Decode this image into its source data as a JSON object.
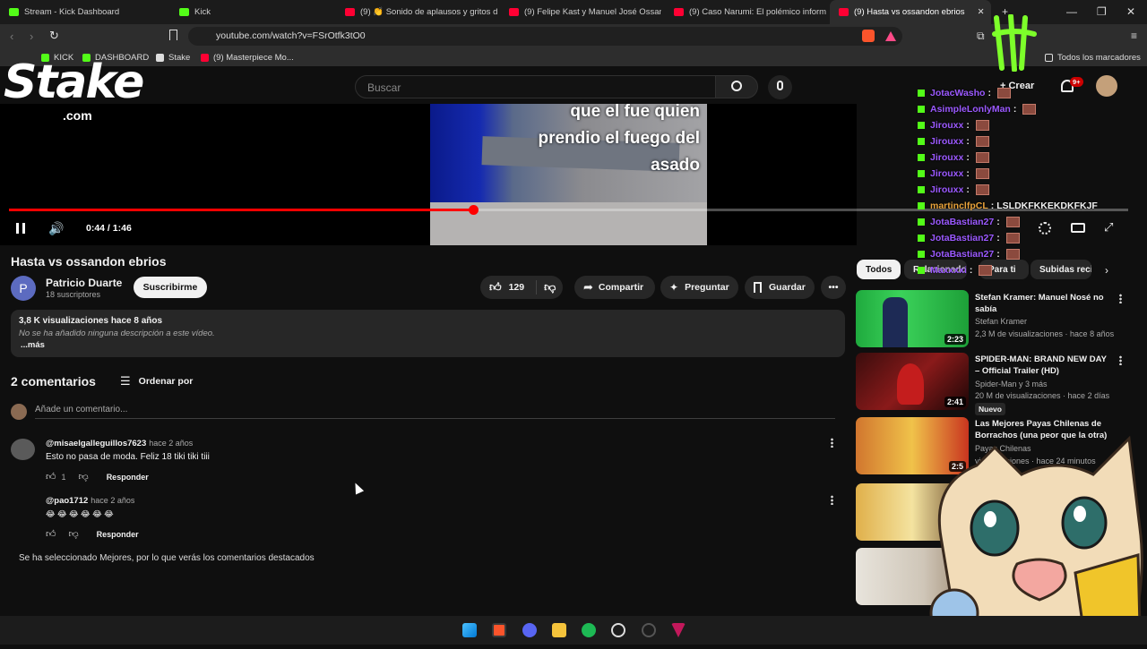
{
  "browser": {
    "tabs": [
      {
        "label": "Stream - Kick Dashboard",
        "favicon": "kick"
      },
      {
        "label": "Kick",
        "favicon": "kick"
      },
      {
        "label": "(9) 👏 Sonido de aplausos y gritos de",
        "favicon": "youtube"
      },
      {
        "label": "(9) Felipe Kast y Manuel José Ossand",
        "favicon": "youtube"
      },
      {
        "label": "(9) Caso Narumi: El polémico informe",
        "favicon": "youtube"
      },
      {
        "label": "(9) Hasta vs ossandon ebrios",
        "favicon": "youtube",
        "active": true
      }
    ],
    "url": "youtube.com/watch?v=FSrOtfk3tO0",
    "bookmarks": [
      {
        "label": "KICK",
        "icon": "kick"
      },
      {
        "label": "DASHBOARD",
        "icon": "kick"
      },
      {
        "label": "Stake",
        "icon": "stake"
      },
      {
        "label": "(9) Masterpiece Mo...",
        "icon": "youtube"
      }
    ],
    "all_bookmarks_label": "Todos los marcadores"
  },
  "youtube": {
    "search_placeholder": "Buscar",
    "create_label": "Crear",
    "notification_count": "9+",
    "player": {
      "caption_line1": "que el fue quien",
      "caption_line2": "prendio el fuego del",
      "caption_line3": "asado",
      "time": "0:44 / 1:46",
      "progress": 0.4151
    },
    "video": {
      "title": "Hasta vs ossandon ebrios",
      "channel": "Patricio Duarte",
      "channel_initial": "P",
      "subscribers": "18 suscriptores",
      "subscribe_label": "Suscribirme",
      "likes": "129",
      "share_label": "Compartir",
      "ask_label": "Preguntar",
      "save_label": "Guardar",
      "views_date": "3,8 K visualizaciones  hace 8 años",
      "description": "No se ha añadido ninguna descripción a este vídeo.",
      "more_label": "...más"
    },
    "comments": {
      "count_label": "2 comentarios",
      "sort_label": "Ordenar por",
      "add_placeholder": "Añade un comentario...",
      "items": [
        {
          "author": "@misaelgalleguillos7623",
          "time": "hace 2 años",
          "text": "Esto no pasa de moda. Feliz 18 tiki tiki tiii",
          "likes": "1",
          "reply": "Responder"
        },
        {
          "author": "@pao1712",
          "time": "hace 2 años",
          "text": "😂 😂 😂 😂 😂 😂",
          "likes": "",
          "reply": "Responder"
        }
      ],
      "notice": "Se ha seleccionado Mejores, por lo que verás los comentarios destacados"
    },
    "chips": [
      "Todos",
      "Relacionado",
      "Para ti",
      "Subidas recientes"
    ],
    "related": [
      {
        "title": "Stefan Kramer: Manuel Nosé no sabía",
        "channel": "Stefan Kramer",
        "stats": "2,3 M de visualizaciones · hace 8 años",
        "duration": "2:23",
        "verified": true
      },
      {
        "title": "SPIDER-MAN: BRAND NEW DAY – Official Trailer (HD)",
        "channel": "Spider-Man  y 3 más",
        "stats": "20 M de visualizaciones · hace 2 días",
        "duration": "2:41",
        "verified": true,
        "badge": "Nuevo"
      },
      {
        "title": "Las Mejores Payas Chilenas de Borrachos (una peor que la otra)",
        "channel": "Payas Chilenas",
        "stats": "visualizaciones · hace 24 minutos",
        "duration": "2:5"
      },
      {
        "title": "",
        "channel": "",
        "stats": "",
        "duration": ""
      },
      {
        "title": "",
        "channel": "",
        "stats": "",
        "duration": ""
      }
    ]
  },
  "overlay": {
    "stake_logo": "Stake",
    "stake_sub": ".com",
    "chat": [
      {
        "user": "JotacWasho",
        "msg": "",
        "color": "#9b59ff"
      },
      {
        "user": "AsimpleLonlyMan",
        "msg": "",
        "color": "#9b59ff"
      },
      {
        "user": "Jirouxx",
        "msg": "",
        "color": "#9b59ff"
      },
      {
        "user": "Jirouxx",
        "msg": "",
        "color": "#9b59ff"
      },
      {
        "user": "Jirouxx",
        "msg": "",
        "color": "#9b59ff"
      },
      {
        "user": "Jirouxx",
        "msg": "",
        "color": "#9b59ff"
      },
      {
        "user": "Jirouxx",
        "msg": "",
        "color": "#9b59ff"
      },
      {
        "user": "martinclfpCL",
        "msg": "LSLDKFKKEKDKFKJF",
        "color": "#e8a23a"
      },
      {
        "user": "JotaBastian27",
        "msg": "",
        "color": "#9b59ff"
      },
      {
        "user": "JotaBastian27",
        "msg": "",
        "color": "#9b59ff"
      },
      {
        "user": "JotaBastian27",
        "msg": "",
        "color": "#9b59ff"
      },
      {
        "user": "Maxxxxi",
        "msg": "",
        "color": "#9b59ff"
      }
    ]
  }
}
